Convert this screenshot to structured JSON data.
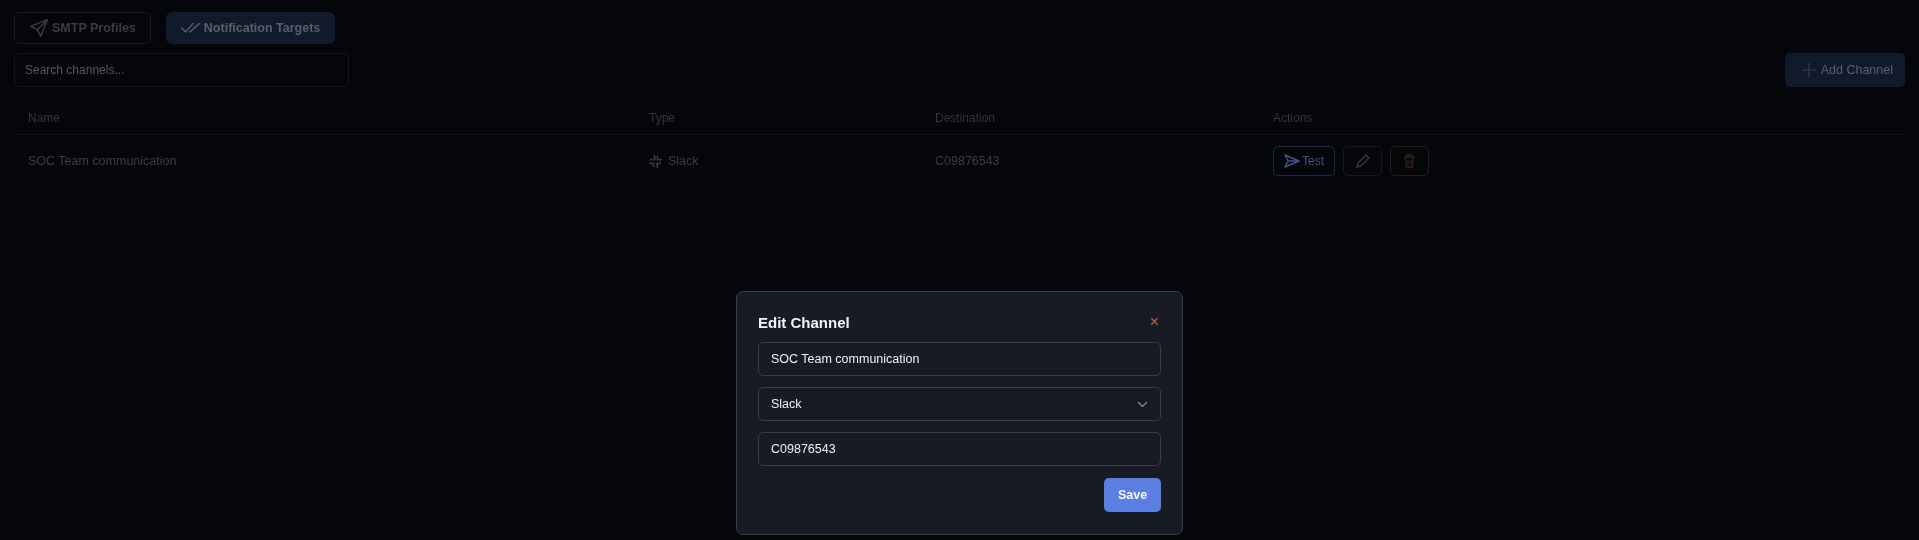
{
  "tabs": [
    {
      "label": "SMTP Profiles",
      "selected": false
    },
    {
      "label": "Notification Targets",
      "selected": true
    }
  ],
  "search": {
    "placeholder": "Search channels..."
  },
  "add_button": "Add Channel",
  "table": {
    "columns": [
      "Name",
      "Type",
      "Destination",
      "Actions"
    ],
    "rows": [
      {
        "name": "SOC Team communication",
        "type": "Slack",
        "destination": "C09876543",
        "test_label": "Test"
      }
    ]
  },
  "dialog": {
    "title": "Edit Channel",
    "close": "×",
    "fields": [
      {
        "kind": "text",
        "value": "SOC Team communication"
      },
      {
        "kind": "select",
        "value": "Slack"
      },
      {
        "kind": "text",
        "value": "C09876543"
      }
    ],
    "save": "Save"
  }
}
